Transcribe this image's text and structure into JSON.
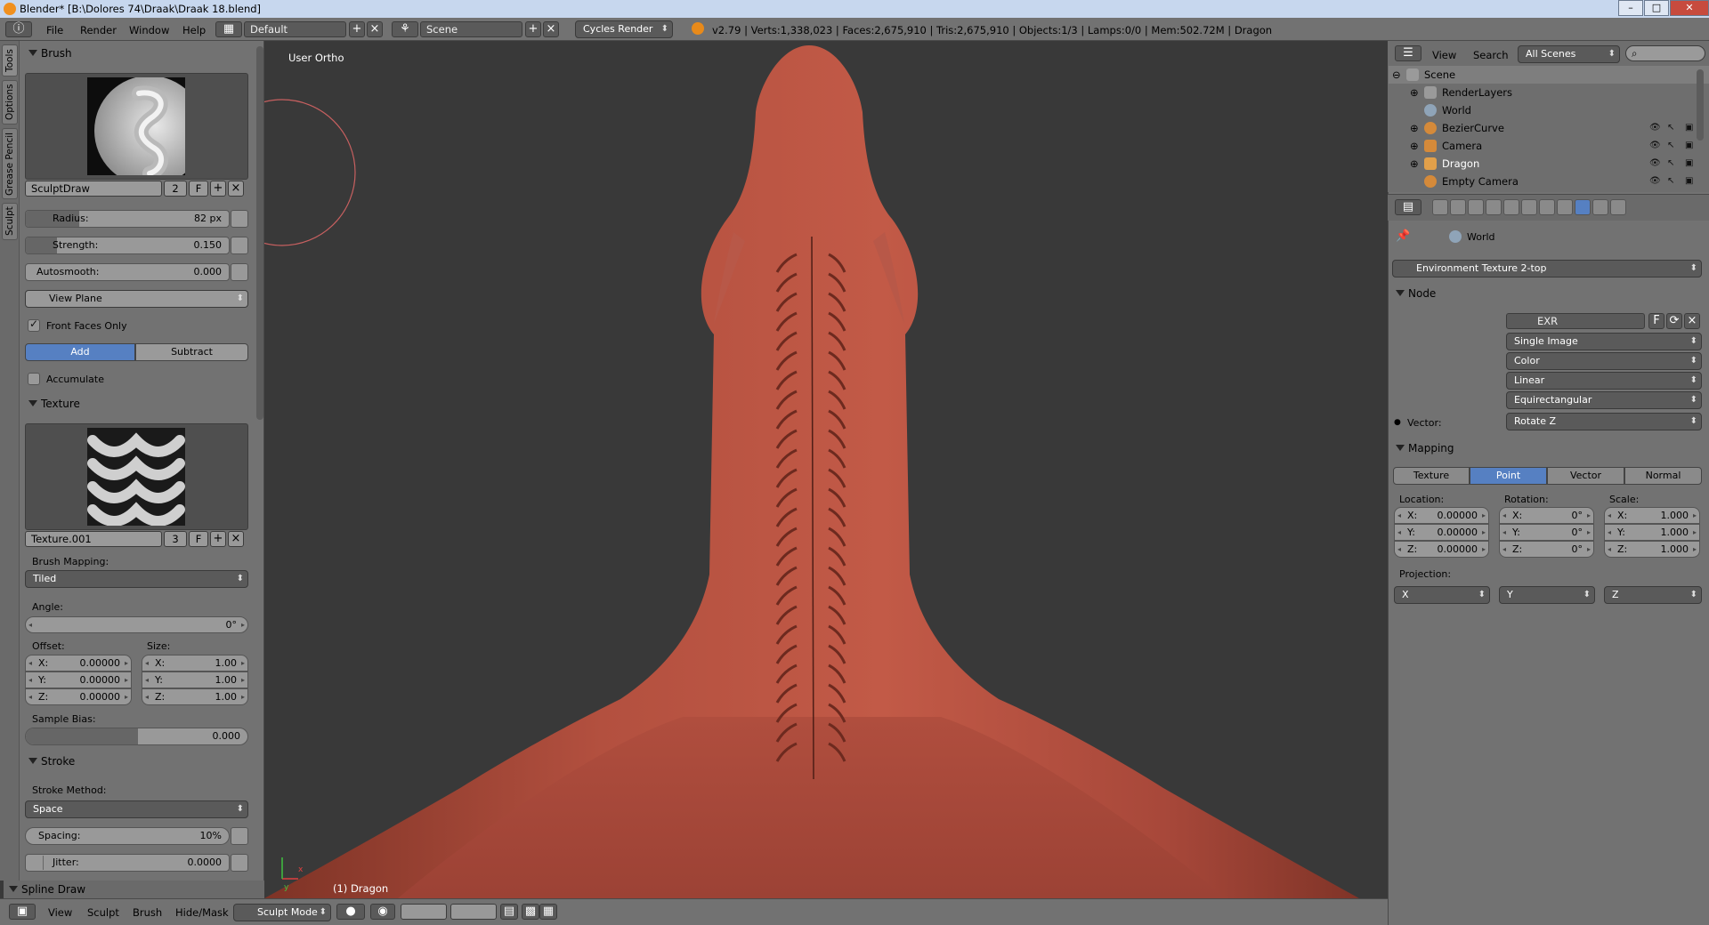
{
  "window": {
    "title": "Blender* [B:\\Dolores 74\\Draak\\Draak 18.blend]"
  },
  "topbar": {
    "menus": [
      "File",
      "Render",
      "Window",
      "Help"
    ],
    "layout": "Default",
    "scene": "Scene",
    "engine": "Cycles Render",
    "stats": "v2.79 | Verts:1,338,023 | Faces:2,675,910 | Tris:2,675,910 | Objects:1/3 | Lamps:0/0 | Mem:502.72M | Dragon"
  },
  "tabs": [
    "Tools",
    "Options",
    "Grease Pencil",
    "Sculpt"
  ],
  "brush": {
    "header": "Brush",
    "name": "SculptDraw",
    "users": "2",
    "fake": "F",
    "radius_label": "Radius:",
    "radius": "82 px",
    "strength_label": "Strength:",
    "strength": "0.150",
    "strength_frac": 0.15,
    "autosmooth_label": "Autosmooth:",
    "autosmooth": "0.000",
    "plane": "View Plane",
    "front_faces": "Front Faces Only",
    "add": "Add",
    "subtract": "Subtract",
    "accumulate": "Accumulate"
  },
  "texture": {
    "header": "Texture",
    "name": "Texture.001",
    "users": "3",
    "fake": "F",
    "mapping_label": "Brush Mapping:",
    "mapping": "Tiled",
    "angle_label": "Angle:",
    "angle": "0°",
    "offset_label": "Offset:",
    "size_label": "Size:",
    "offset": {
      "x": "0.00000",
      "y": "0.00000",
      "z": "0.00000"
    },
    "size": {
      "x": "1.00",
      "y": "1.00",
      "z": "1.00"
    },
    "bias_label": "Sample Bias:",
    "bias": "0.000",
    "bias_frac": 0.5
  },
  "stroke": {
    "header": "Stroke",
    "method_label": "Stroke Method:",
    "method": "Space",
    "spacing_label": "Spacing:",
    "spacing": "10%",
    "jitter_label": "Jitter:",
    "jitter": "0.0000"
  },
  "spline": {
    "header": "Spline Draw"
  },
  "viewport": {
    "view_name": "User Ortho",
    "object_label": "(1) Dragon"
  },
  "bottombar": {
    "menus": [
      "View",
      "Sculpt",
      "Brush",
      "Hide/Mask"
    ],
    "mode": "Sculpt Mode"
  },
  "outliner": {
    "view": "View",
    "search": "Search",
    "filter": "All Scenes",
    "rows": [
      "Scene",
      "RenderLayers",
      "World",
      "BezierCurve",
      "Camera",
      "Dragon",
      "Empty Camera"
    ]
  },
  "properties": {
    "context": "World",
    "texture_node": "Environment Texture 2-top",
    "node_header": "Node",
    "image": "EXR",
    "image_fake": "F",
    "source": "Single Image",
    "color": "Color",
    "interp": "Linear",
    "projection_type": "Equirectangular",
    "vector_label": "Vector:",
    "vector": "Rotate Z",
    "mapping_header": "Mapping",
    "mapping_tabs": [
      "Texture",
      "Point",
      "Vector",
      "Normal"
    ],
    "location_label": "Location:",
    "rotation_label": "Rotation:",
    "scale_label": "Scale:",
    "location": {
      "x": "0.00000",
      "y": "0.00000",
      "z": "0.00000"
    },
    "rotation": {
      "x": "0°",
      "y": "0°",
      "z": "0°"
    },
    "scale": {
      "x": "1.000",
      "y": "1.000",
      "z": "1.000"
    },
    "projection_label": "Projection:",
    "proj": [
      "X",
      "Y",
      "Z"
    ]
  },
  "colors": {
    "active_blue": "#5680c2",
    "dragon": "#b5503f",
    "bg": "#393939",
    "panel": "#727272"
  }
}
